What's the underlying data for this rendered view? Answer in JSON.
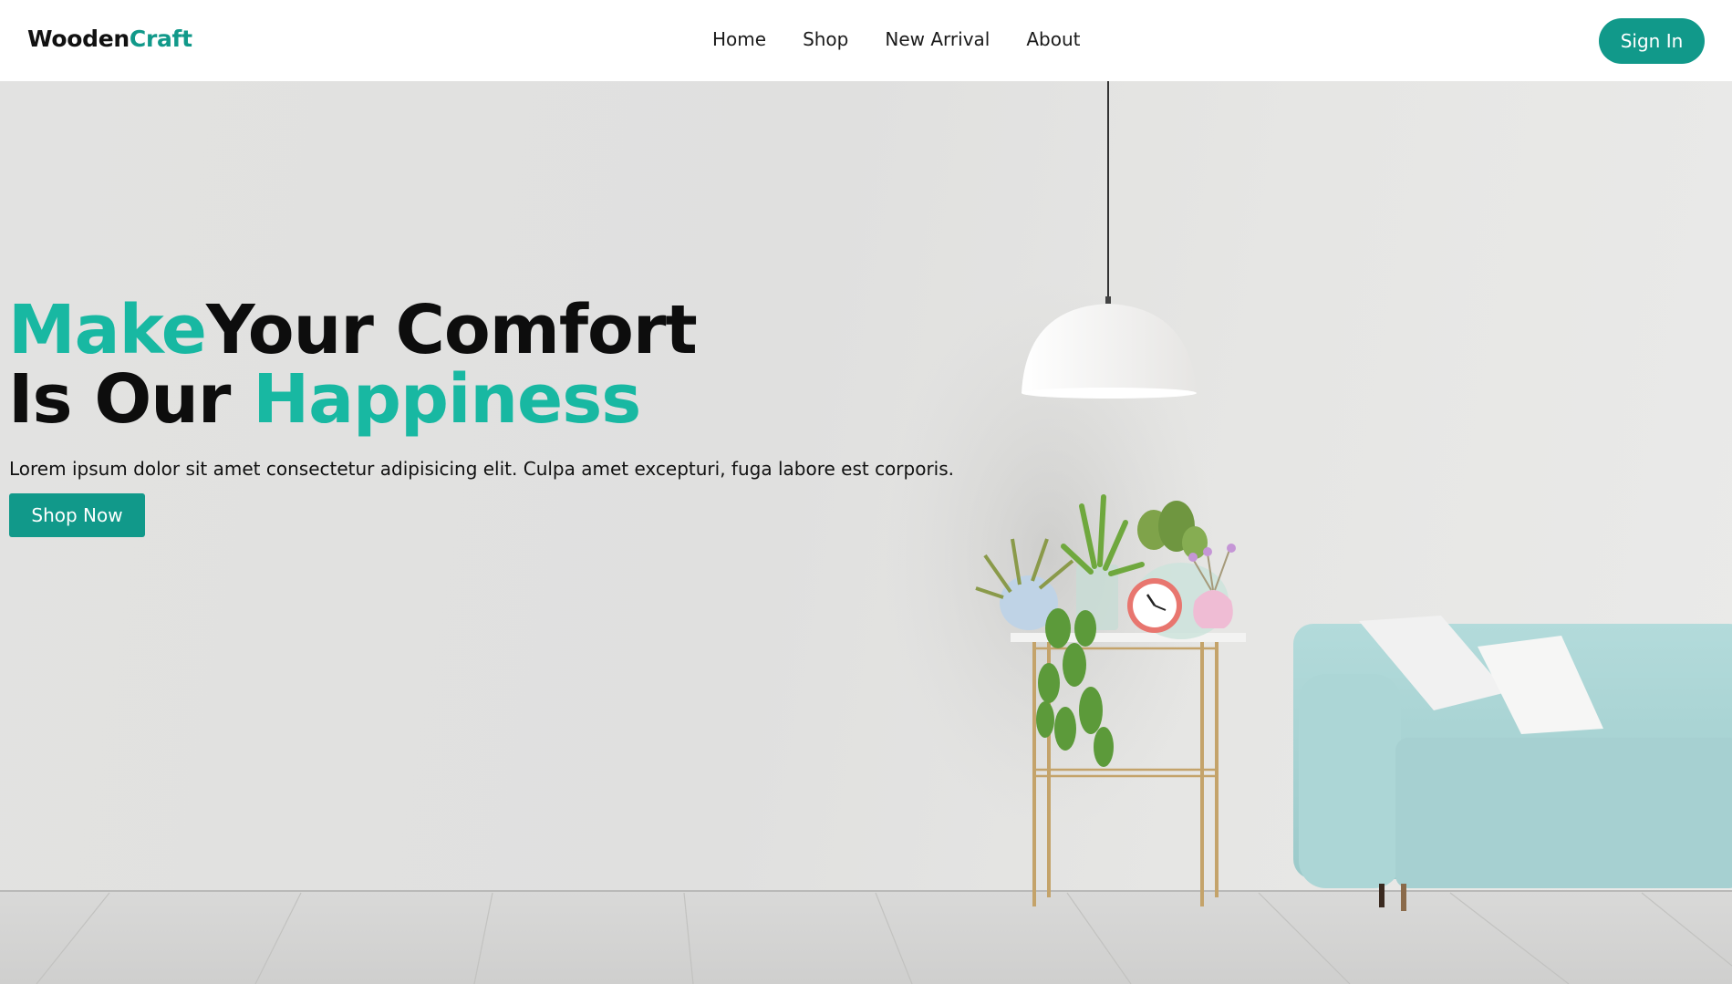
{
  "brand": {
    "part1": "Wooden",
    "part2": "Craft"
  },
  "nav": {
    "items": [
      {
        "label": "Home"
      },
      {
        "label": "Shop"
      },
      {
        "label": "New Arrival"
      },
      {
        "label": "About"
      }
    ],
    "signin_label": "Sign In"
  },
  "hero": {
    "headline_line1_accent": "Make",
    "headline_line1_rest": "Your Comfort",
    "headline_line2_start": "Is Our ",
    "headline_line2_accent": "Happiness",
    "subtitle": "Lorem ipsum dolor sit amet consectetur adipisicing elit. Culpa amet excepturi, fuga labore est corporis.",
    "cta_label": "Shop Now"
  },
  "colors": {
    "accent": "#11998a",
    "headline_accent": "#18b8a2",
    "text": "#111111",
    "wall": "#e2e2e1",
    "sofa": "#a7d3d4"
  },
  "icons": [
    "pendant-lamp-illustration",
    "plant-stand-illustration",
    "clock-illustration",
    "sofa-illustration"
  ]
}
